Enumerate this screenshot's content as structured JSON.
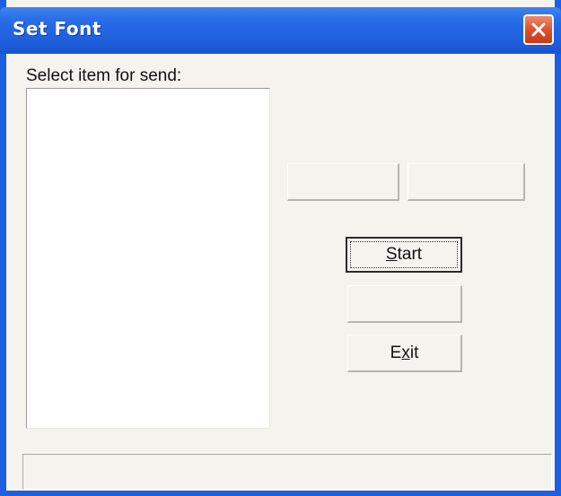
{
  "window": {
    "title": "Set Font",
    "title_color": "#ffffff",
    "titlebar_color": "#2a6ee8",
    "close_button_color": "#e0502e"
  },
  "main": {
    "select_label": "Select item for send:",
    "list_items": [
      "",
      ""
    ]
  },
  "buttons": {
    "top_left_label": "",
    "top_right_label": "",
    "start_label_underlined": "S",
    "start_label_rest": "tart",
    "stop_label": "",
    "exit_label_pre": "E",
    "exit_label_underlined": "x",
    "exit_label_rest": "it"
  },
  "status": {
    "text": ""
  },
  "icons": {
    "close": "close-icon"
  }
}
